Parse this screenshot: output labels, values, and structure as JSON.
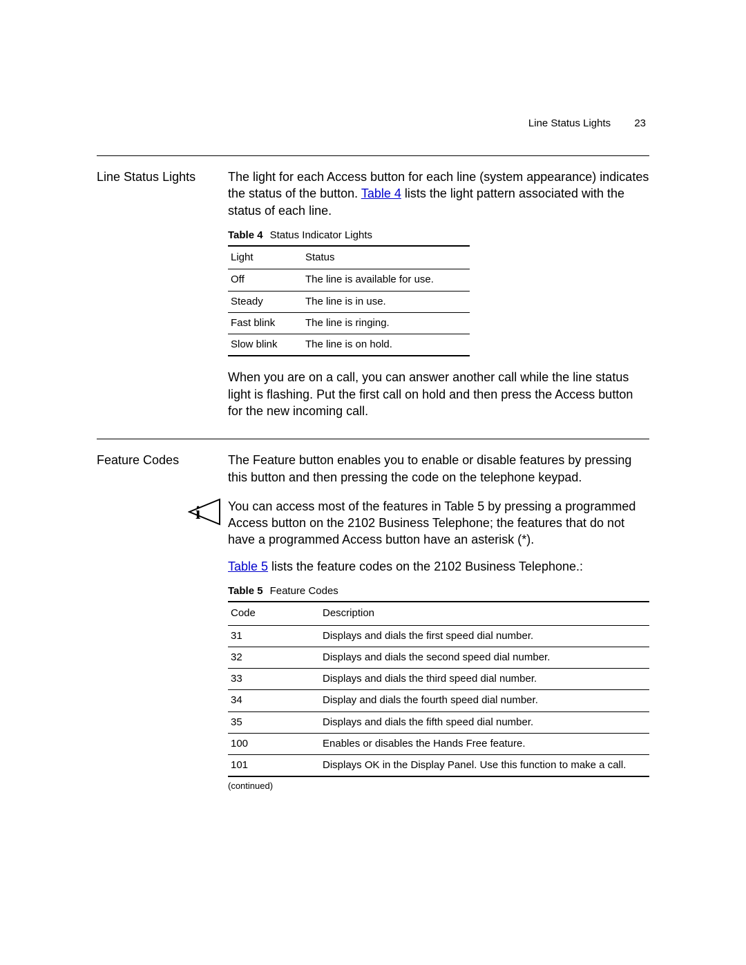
{
  "header": {
    "title": "Line Status Lights",
    "page": "23"
  },
  "s1": {
    "heading": "Line Status Lights",
    "p1a": "The light for each Access button for each line (system appearance) indicates the status of the button. ",
    "p1link": "Table 4",
    "p1b": " lists the light pattern associated with the status of each line.",
    "t4": {
      "capnum": "Table 4",
      "capname": "Status Indicator Lights",
      "h1": "Light",
      "h2": "Status",
      "rows": [
        {
          "c1": "Off",
          "c2": "The line is available for use."
        },
        {
          "c1": "Steady",
          "c2": "The line is in use."
        },
        {
          "c1": "Fast blink",
          "c2": "The line is ringing."
        },
        {
          "c1": "Slow blink",
          "c2": "The line is on hold."
        }
      ]
    },
    "p2": "When you are on a call, you can answer another call while the line status light is flashing. Put the first call on hold and then press the Access button for the new incoming call."
  },
  "s2": {
    "heading": "Feature Codes",
    "p1": "The Feature button enables you to enable or disable features by pressing this button and then pressing the code on the telephone keypad.",
    "note": "You can access most of the features in Table 5 by pressing a programmed Access button on the 2102 Business Telephone; the features that do not have a programmed Access button have an asterisk (*).",
    "p2link": "Table 5",
    "p2b": " lists the feature codes on the 2102 Business Telephone.:",
    "t5": {
      "capnum": "Table 5",
      "capname": "Feature Codes",
      "h1": "Code",
      "h2": "Description",
      "rows": [
        {
          "c1": "31",
          "c2": "Displays and dials the first speed dial number."
        },
        {
          "c1": "32",
          "c2": "Displays and dials the second speed dial number."
        },
        {
          "c1": "33",
          "c2": "Displays and dials the third speed dial number."
        },
        {
          "c1": "34",
          "c2": "Display and dials the fourth speed dial number."
        },
        {
          "c1": "35",
          "c2": "Displays and dials the fifth speed dial number."
        },
        {
          "c1": "100",
          "c2": "Enables or disables the Hands Free feature."
        },
        {
          "c1": "101",
          "c2": "Displays OK in the Display Panel. Use this function to make a call."
        }
      ],
      "continued": "(continued)"
    }
  }
}
